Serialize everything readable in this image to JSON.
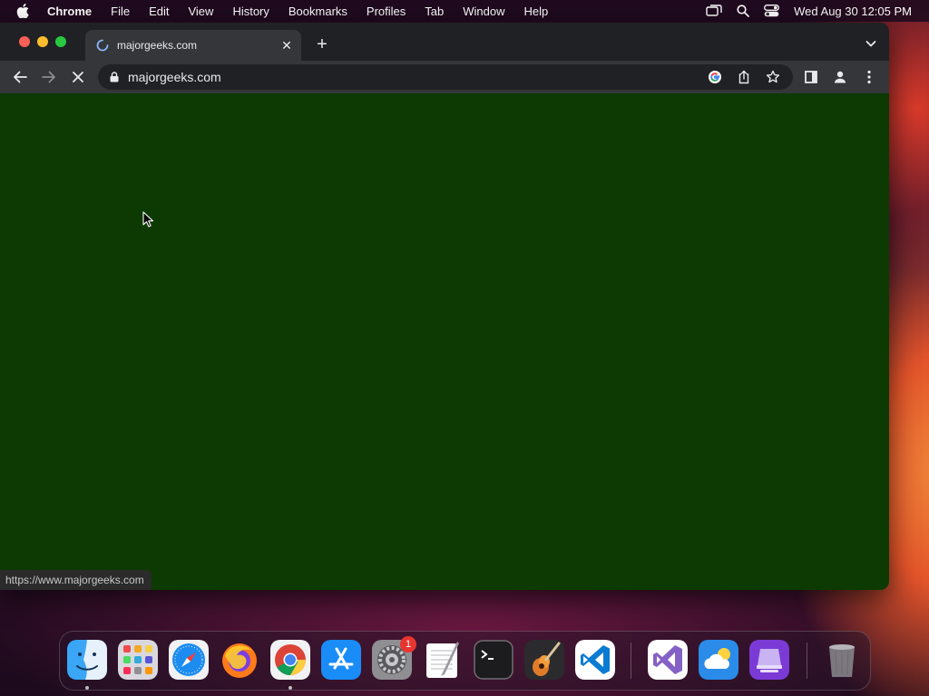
{
  "menubar": {
    "app_name": "Chrome",
    "items": [
      "File",
      "Edit",
      "View",
      "History",
      "Bookmarks",
      "Profiles",
      "Tab",
      "Window",
      "Help"
    ],
    "clock": "Wed Aug 30  12:05 PM"
  },
  "browser": {
    "tab_title": "majorgeeks.com",
    "tab_close_glyph": "✕",
    "new_tab_glyph": "+",
    "address": "majorgeeks.com",
    "status_url": "https://www.majorgeeks.com",
    "page_background": "#0c3a02"
  },
  "dock": {
    "apps": [
      {
        "name": "Finder",
        "icon": "finder-icon"
      },
      {
        "name": "Launchpad",
        "icon": "launchpad-icon"
      },
      {
        "name": "Safari",
        "icon": "safari-icon"
      },
      {
        "name": "Firefox",
        "icon": "firefox-icon"
      },
      {
        "name": "Chrome",
        "icon": "chrome-icon"
      },
      {
        "name": "App Store",
        "icon": "app-store-icon"
      },
      {
        "name": "System Settings",
        "icon": "settings-icon",
        "badge": "1"
      },
      {
        "name": "TextEdit",
        "icon": "textedit-icon"
      },
      {
        "name": "Terminal",
        "icon": "terminal-icon"
      },
      {
        "name": "GarageBand",
        "icon": "garageband-icon"
      },
      {
        "name": "Visual Studio Code",
        "icon": "vscode-icon"
      },
      {
        "name": "Visual Studio",
        "icon": "visual-studio-icon"
      },
      {
        "name": "Weather",
        "icon": "weather-icon"
      },
      {
        "name": "Simulator",
        "icon": "simulator-icon"
      },
      {
        "name": "Trash",
        "icon": "trash-icon"
      }
    ]
  }
}
